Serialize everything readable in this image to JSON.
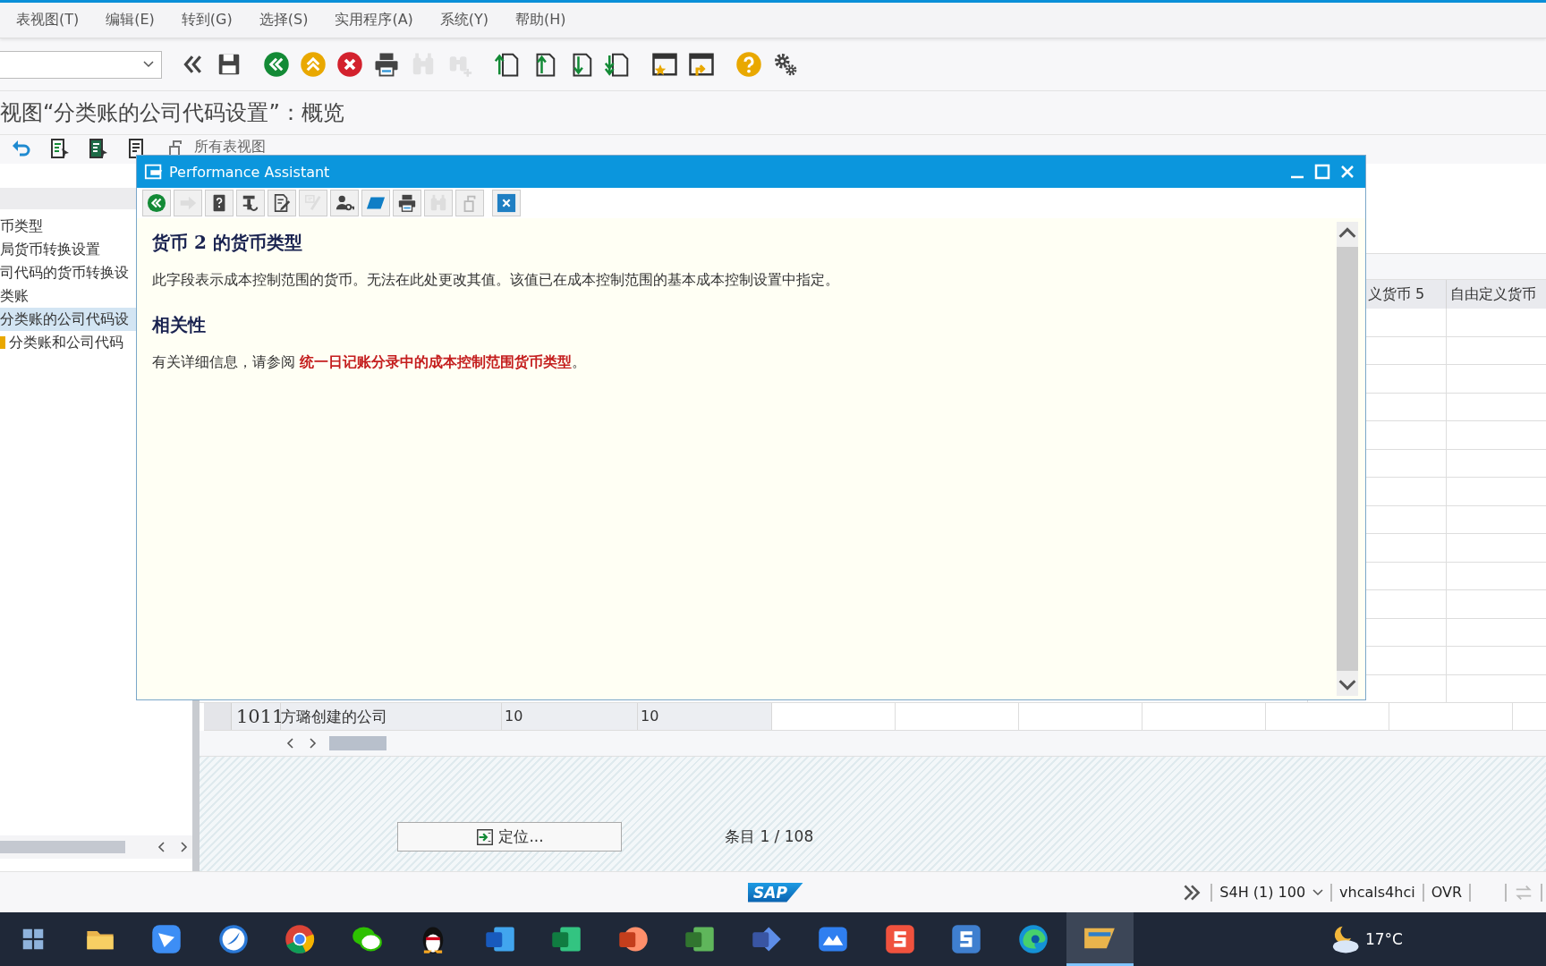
{
  "menu": [
    "表视图(T)",
    "编辑(E)",
    "转到(G)",
    "选择(S)",
    "实用程序(A)",
    "系统(Y)",
    "帮助(H)"
  ],
  "toolbar_buttons": [
    {
      "kind": "exit",
      "disabled": false
    },
    {
      "kind": "save",
      "disabled": false
    },
    {
      "kind": "back",
      "disabled": false
    },
    {
      "kind": "up",
      "disabled": false
    },
    {
      "kind": "cancel",
      "disabled": false
    },
    {
      "kind": "print",
      "disabled": false
    },
    {
      "kind": "find",
      "disabled": true
    },
    {
      "kind": "find-next",
      "disabled": true
    },
    {
      "kind": "first-page",
      "disabled": false
    },
    {
      "kind": "prev-page",
      "disabled": false
    },
    {
      "kind": "next-page",
      "disabled": false
    },
    {
      "kind": "last-page",
      "disabled": false
    },
    {
      "kind": "new-session",
      "disabled": false
    },
    {
      "kind": "shortcut",
      "disabled": false
    },
    {
      "kind": "help",
      "disabled": false
    },
    {
      "kind": "settings",
      "disabled": false
    }
  ],
  "title": "视图“分类账的公司代码设置”：概览",
  "app_toolbar": {
    "buttons": [
      {
        "kind": "undo"
      },
      {
        "kind": "details"
      },
      {
        "kind": "details-dark"
      },
      {
        "kind": "document"
      },
      {
        "kind": "copy"
      }
    ],
    "all_views_label": "所有表视图"
  },
  "sidebar": {
    "items": [
      {
        "label": "币类型",
        "selected": false,
        "kind": "plain"
      },
      {
        "label": "局货币转换设置",
        "selected": false,
        "kind": "plain"
      },
      {
        "label": "司代码的货币转换设",
        "selected": false,
        "kind": "plain"
      },
      {
        "label": "类账",
        "selected": false,
        "kind": "plain"
      },
      {
        "label": "分类账的公司代码设",
        "selected": true,
        "kind": "plain"
      },
      {
        "label": "分类账和公司代码",
        "selected": false,
        "kind": "folder"
      }
    ]
  },
  "table": {
    "columns": [
      "义货币 5",
      "自由定义货币"
    ],
    "rows": [
      {
        "cells": [
          "1011",
          "方璐创建的公司",
          "10",
          "10"
        ]
      }
    ]
  },
  "position_button": "定位...",
  "entry_counter": "条目 1 / 108",
  "status_bar": {
    "logo": "SAP",
    "system": "S4H (1) 100",
    "server": "vhcals4hci",
    "mode": "OVR"
  },
  "popup": {
    "title": "Performance Assistant",
    "toolbar": [
      {
        "kind": "back",
        "disabled": false
      },
      {
        "kind": "forward",
        "disabled": true
      },
      {
        "kind": "help-book",
        "disabled": false
      },
      {
        "kind": "tools",
        "disabled": false
      },
      {
        "kind": "edit",
        "disabled": false
      },
      {
        "kind": "link",
        "disabled": true
      },
      {
        "kind": "user-key",
        "disabled": false
      },
      {
        "kind": "bookmark",
        "disabled": false
      },
      {
        "kind": "print",
        "disabled": false
      },
      {
        "kind": "find",
        "disabled": true
      },
      {
        "kind": "copy",
        "disabled": true
      },
      {
        "kind": "close",
        "disabled": false
      }
    ],
    "heading": "货币 2 的货币类型",
    "body": "此字段表示成本控制范围的货币。无法在此处更改其值。该值已在成本控制范围的基本成本控制设置中指定。",
    "section_heading": "相关性",
    "related": {
      "text": "有关详细信息，请参阅",
      "link": "统一日记账分录中的成本控制范围货币类型",
      "after": "。"
    }
  },
  "taskbar": {
    "apps": [
      {
        "kind": "start",
        "selected": false
      },
      {
        "kind": "folder",
        "selected": false
      },
      {
        "kind": "bird",
        "selected": false
      },
      {
        "kind": "feather",
        "selected": false
      },
      {
        "kind": "chrome",
        "selected": false
      },
      {
        "kind": "chat",
        "selected": false
      },
      {
        "kind": "penguin",
        "selected": false
      },
      {
        "kind": "word",
        "selected": false
      },
      {
        "kind": "excel",
        "selected": false
      },
      {
        "kind": "powerpoint",
        "selected": false
      },
      {
        "kind": "project",
        "selected": false
      },
      {
        "kind": "visio",
        "selected": false
      },
      {
        "kind": "cloud-app",
        "selected": false
      },
      {
        "kind": "red-s",
        "selected": false
      },
      {
        "kind": "blue-s",
        "selected": false
      },
      {
        "kind": "edge",
        "selected": false
      },
      {
        "kind": "sap",
        "selected": true
      }
    ],
    "weather": "17°C"
  }
}
